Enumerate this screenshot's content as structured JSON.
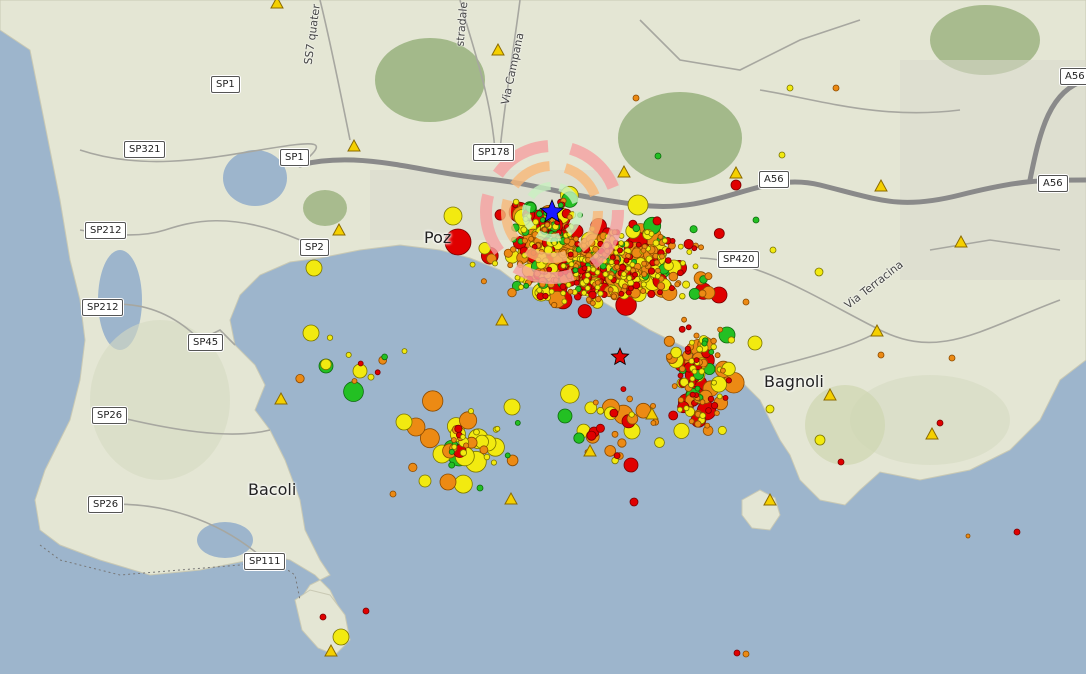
{
  "map": {
    "colors": {
      "sea": "#9db5cc",
      "land": "#e4e6d4",
      "crater": "#98b07c",
      "road": "#8a8a8a",
      "mag_red": "#e00000",
      "mag_orange": "#ec8a14",
      "mag_yellow": "#f2ea10",
      "mag_green": "#23c023",
      "station_triangle": "#f5d000",
      "epicenter_star": "#1a1aff"
    },
    "place_labels": {
      "pozzuoli": "Poz",
      "bagnoli": "Bagnoli",
      "bacoli": "Bacoli"
    },
    "street_labels": {
      "ss7_quater": "SS7 quater",
      "via_campana": "Via Campana",
      "via_terracina": "Via Terracina",
      "stradale": "stradale"
    },
    "road_shields": {
      "sp1_a": "SP1",
      "sp1_b": "SP1",
      "sp321": "SP321",
      "sp178": "SP178",
      "a56_a": "A56",
      "a56_b": "A56",
      "a56_c": "A56",
      "sp212_a": "SP212",
      "sp212_b": "SP212",
      "sp2": "SP2",
      "sp420": "SP420",
      "sp45": "SP45",
      "sp26_a": "SP26",
      "sp26_b": "SP26",
      "sp111": "SP111"
    },
    "icons": [
      "earthquake-marker",
      "seismic-station-icon",
      "epicenter-star-icon",
      "shakemap-rings"
    ]
  }
}
